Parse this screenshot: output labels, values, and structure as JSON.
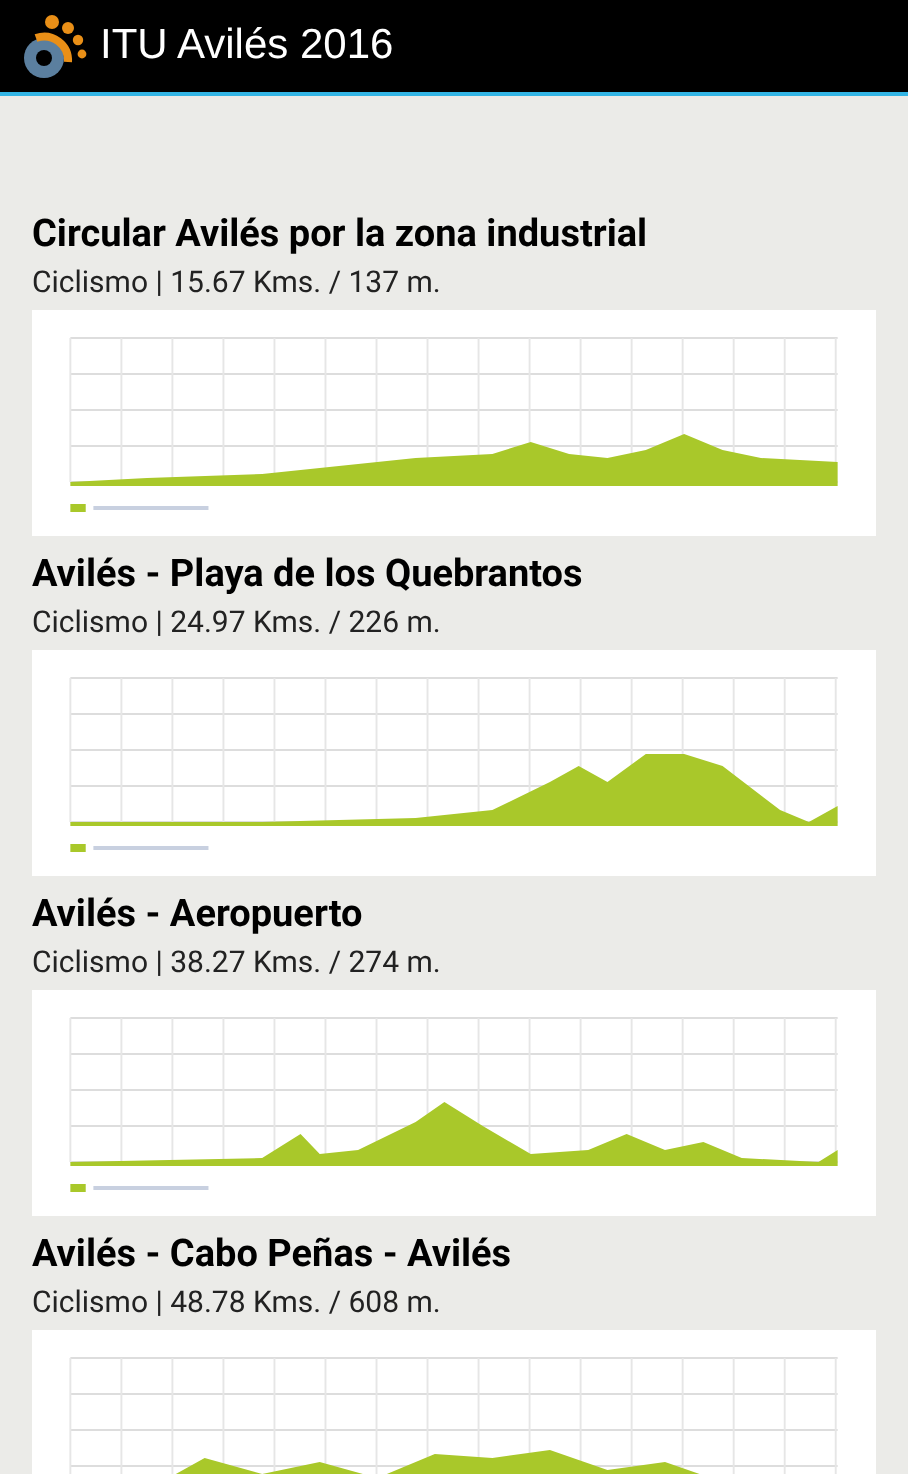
{
  "app_bar": {
    "title": "ITU Avilés 2016"
  },
  "routes": [
    {
      "title": "Circular Avilés por la zona industrial",
      "subtitle": "Ciclismo | 15.67 Kms. / 137 m."
    },
    {
      "title": "Avilés - Playa de los Quebrantos",
      "subtitle": "Ciclismo | 24.97 Kms. / 226 m."
    },
    {
      "title": "Avilés - Aeropuerto",
      "subtitle": "Ciclismo | 38.27 Kms. / 274 m."
    },
    {
      "title": "Avilés - Cabo Peñas - Avilés",
      "subtitle": "Ciclismo | 48.78 Kms. / 608 m."
    }
  ]
}
